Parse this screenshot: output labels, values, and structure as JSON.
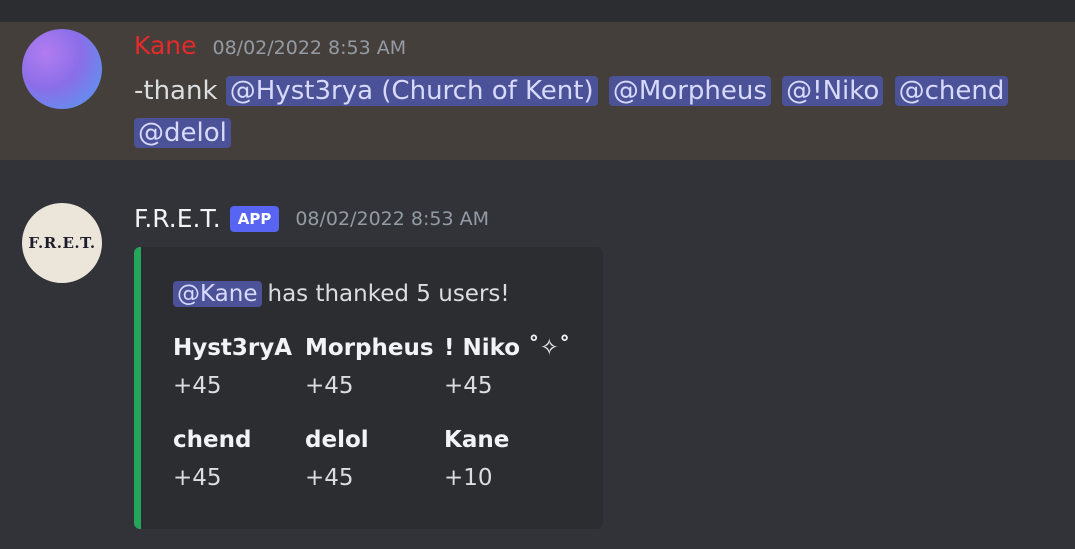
{
  "messages": [
    {
      "author": "Kane",
      "author_color": "#e52a2a",
      "timestamp": "08/02/2022 8:53 AM",
      "text": "-thank",
      "mentions": [
        "@Hyst3rya (Church of Kent)",
        "@Morpheus",
        "@!Niko",
        "@chend",
        "@delol"
      ],
      "highlighted": true
    },
    {
      "author": "F.R.E.T.",
      "avatar_text": "F.R.E.T.",
      "badge": "APP",
      "timestamp": "08/02/2022 8:53 AM",
      "embed": {
        "accent_color": "#23a55a",
        "mention": "@Kane",
        "description": "has thanked 5 users!",
        "fields": [
          {
            "name": "Hyst3ryA",
            "value": "+45"
          },
          {
            "name": "Morpheus",
            "value": "+45"
          },
          {
            "name": "! Niko ˚✧˚",
            "value": "+45"
          },
          {
            "name": "chend",
            "value": "+45"
          },
          {
            "name": "delol",
            "value": "+45"
          },
          {
            "name": "Kane",
            "value": "+10"
          }
        ]
      }
    }
  ]
}
